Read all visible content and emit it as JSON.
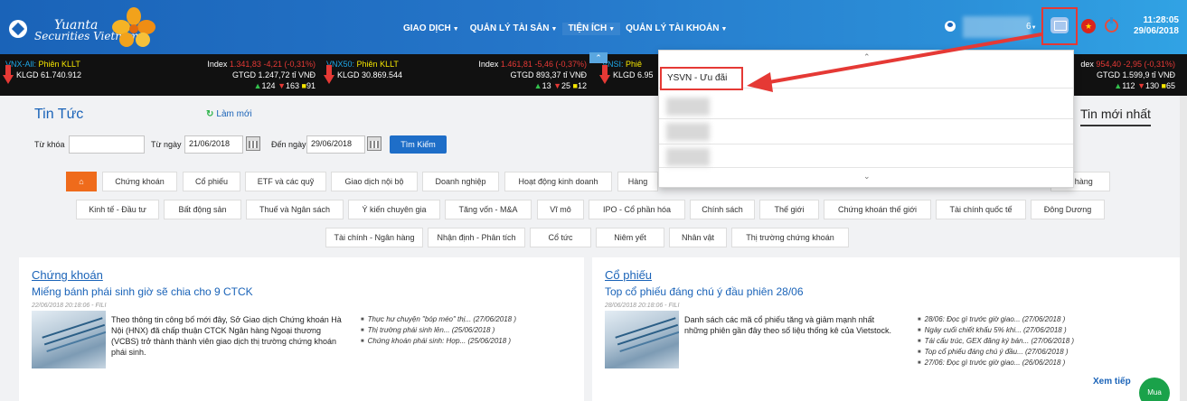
{
  "brand": {
    "name": "Yuanta Securities Vietnam",
    "line1": "Yuanta",
    "line2": "Securities Vietnam"
  },
  "nav": {
    "items": [
      "GIAO DỊCH",
      "QUẢN LÝ TÀI SẢN",
      "TIỆN ÍCH",
      "QUẢN LÝ TÀI KHOẢN"
    ]
  },
  "header": {
    "user_count": "6",
    "time": "11:28:05",
    "date": "29/06/2018"
  },
  "ticker": [
    {
      "name": "VNX-All:",
      "session": "Phiên KLLT",
      "index_label": "Index",
      "index": "1.341,83",
      "change": "-4,21 (-0,31%)",
      "klgd": "KLGD 61.740.912",
      "gtgd": "GTGD 1.247,72 tỉ VNĐ",
      "up": "124",
      "down": "163",
      "flat": "91"
    },
    {
      "name": "VNX50:",
      "session": "Phiên KLLT",
      "index_label": "Index",
      "index": "1.461,81",
      "change": "-5,46 (-0,37%)",
      "klgd": "KLGD 30.869.544",
      "gtgd": "GTGD 893,37 tỉ VNĐ",
      "up": "13",
      "down": "25",
      "flat": "12"
    },
    {
      "name": "VNSI:",
      "session": "Phiê",
      "klgd": "KLGD 6.95"
    },
    {
      "index_label": "dex",
      "index": "954,40",
      "change": "-2,95 (-0,31%)",
      "gtgd": "GTGD 1.599,9 tỉ VNĐ",
      "up": "112",
      "down": "130",
      "flat": "65"
    }
  ],
  "news": {
    "title": "Tin Tức",
    "refresh": "Làm mới",
    "latest_tab": "Tin mới nhất",
    "filters": {
      "keyword_label": "Từ khóa",
      "keyword_value": "",
      "from_label": "Từ ngày",
      "from_value": "21/06/2018",
      "to_label": "Đến ngày",
      "to_value": "29/06/2018",
      "search": "Tìm Kiếm"
    },
    "categories_row1": [
      "Chứng khoán",
      "Cổ phiếu",
      "ETF và các quỹ",
      "Giao dịch nội bộ",
      "Doanh nghiệp",
      "Hoạt động kinh doanh",
      "Hàng",
      "n hàng"
    ],
    "categories_row2": [
      "Kinh tế - Đầu tư",
      "Bất động sản",
      "Thuế và Ngân sách",
      "Ý kiến chuyên gia",
      "Tăng vốn - M&A",
      "Vĩ mô",
      "IPO - Cổ phần hóa",
      "Chính sách",
      "Thế giới",
      "Chứng khoán thế giới",
      "Tài chính quốc tế",
      "Đông Dương"
    ],
    "categories_row3": [
      "Tài chính - Ngân hàng",
      "Nhận định - Phân tích",
      "Cổ tức",
      "Niêm yết",
      "Nhân vật",
      "Thị trường chứng khoán"
    ],
    "sections": [
      {
        "title": "Chứng khoán",
        "headline": "Miếng bánh phái sinh giờ sẽ chia cho 9 CTCK",
        "meta": "22/06/2018 20:18:06 - FILI",
        "summary": "Theo thông tin công bố mới đây, Sở Giao dịch Chứng khoán Hà Nội (HNX) đã chấp thuận CTCK Ngân hàng Ngoại thương (VCBS) trở thành thành viên giao dịch thị trường chứng khoán phái sinh.",
        "related": [
          "Thực hư chuyện \"bóp méo\" thị... (27/06/2018 )",
          "Thị trường phái sinh lên... (25/06/2018 )",
          "Chứng khoán phái sinh: Hợp... (25/06/2018 )"
        ]
      },
      {
        "title": "Cổ phiếu",
        "headline": "Top cổ phiếu đáng chú ý đầu phiên 28/06",
        "meta": "28/06/2018 20:18:06 - FILI",
        "summary": "Danh sách các mã cổ phiếu tăng và giảm mạnh nhất những phiên gần đây theo số liệu thống kê của Vietstock.",
        "related": [
          "28/06: Đọc gì trước giờ giao... (27/06/2018 )",
          "Ngày cuối chiết khấu 5% khi... (27/06/2018 )",
          "Tái cấu trúc, GEX đăng ký bán... (27/06/2018 )",
          "Top cổ phiếu đáng chú ý đầu... (27/06/2018 )",
          "27/06: Đọc gì trước giờ giao... (26/06/2018 )"
        ]
      }
    ],
    "more": "Xem tiếp",
    "buy": "Mua"
  },
  "dropdown": {
    "highlighted_item": "YSVN - Ưu đãi"
  },
  "colors": {
    "brand_blue": "#1a63b8",
    "accent_orange": "#ef6b1b",
    "callout_red": "#e53935",
    "buy_green": "#1aa24a"
  }
}
